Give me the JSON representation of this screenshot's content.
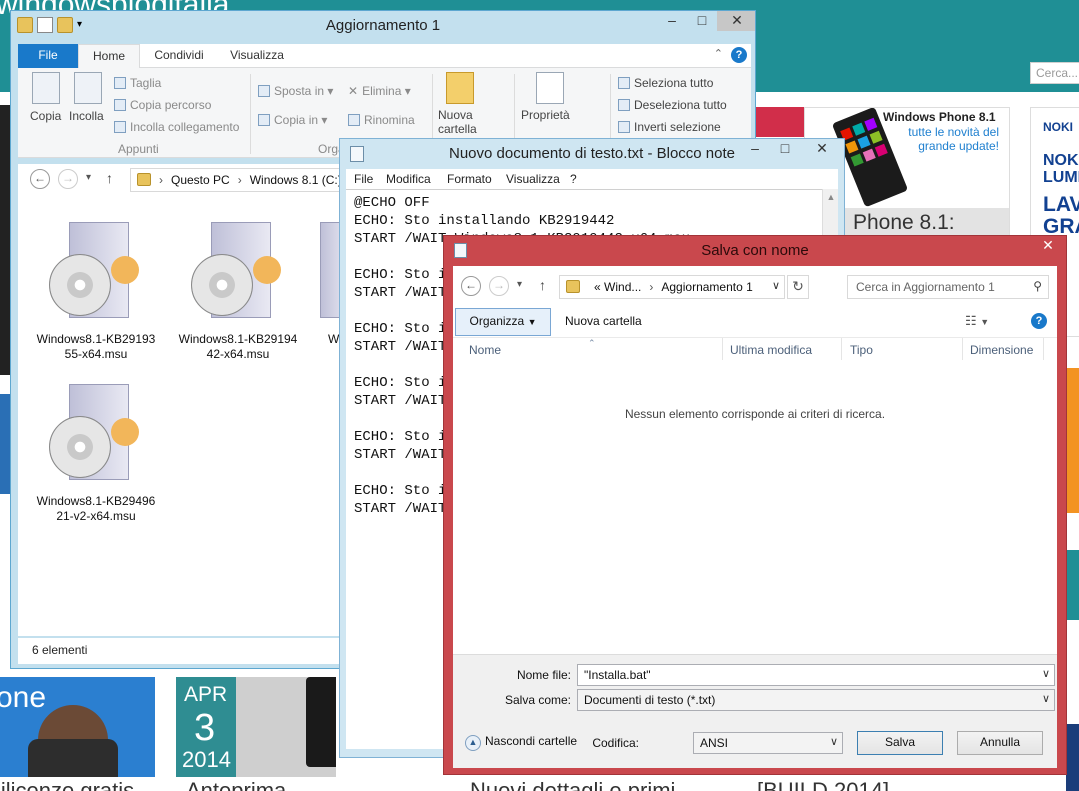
{
  "background": {
    "logo": "windowsblogitalia",
    "search_placeholder": "Cerca...",
    "ad_wp_title": "Windows Phone 8.1",
    "ad_wp_subtitle": "tutte le novità del grande update!",
    "ad_wp_bottom": "Phone 8.1:",
    "ad_nokia_1": "NOKI",
    "ad_nokia_2": "NOK LUMI",
    "ad_nokia_3": "LAV GRA",
    "news1_text": "one",
    "news2_month": "APR",
    "news2_day": "3",
    "news2_year": "2014",
    "bottom_titles": [
      "lilicenze gratis",
      "Anteprima",
      "Nuovi dettagli e primi",
      "[BUILD 2014]"
    ]
  },
  "explorer": {
    "title": "Aggiornamento 1",
    "tabs": [
      "File",
      "Home",
      "Condividi",
      "Visualizza"
    ],
    "ribbon": {
      "copy": "Copia",
      "paste": "Incolla",
      "cut": "Taglia",
      "copy_path": "Copia percorso",
      "paste_link": "Incolla collegamento",
      "group_clipboard": "Appunti",
      "move_to": "Sposta in",
      "copy_to": "Copia in",
      "delete": "Elimina",
      "rename": "Rinomina",
      "group_organize": "Organi",
      "new_folder": "Nuova cartella",
      "properties": "Proprietà",
      "select_all": "Seleziona tutto",
      "deselect_all": "Deseleziona tutto",
      "invert_selection": "Inverti selezione"
    },
    "address": [
      "Questo PC",
      "Windows 8.1 (C:)"
    ],
    "files": [
      {
        "name": "Windows8.1-KB2919355-x64.msu"
      },
      {
        "name": "Windows8.1-KB2919442-x64.msu"
      },
      {
        "name": "Wi"
      },
      {
        "name": "Windows8.1-KB2949621-v2-x64.msu"
      }
    ],
    "status": "6 elementi"
  },
  "notepad": {
    "title": "Nuovo documento di testo.txt - Blocco note",
    "menu": [
      "File",
      "Modifica",
      "Formato",
      "Visualizza",
      "?"
    ],
    "content": "@ECHO OFF\nECHO: Sto installando KB2919442\nSTART /WAIT Windows8.1-KB2919442-x64.msu\n\nECHO: Sto i\nSTART /WAIT\n\nECHO: Sto i\nSTART /WAIT\n\nECHO: Sto i\nSTART /WAIT\n\nECHO: Sto i\nSTART /WAIT\n\nECHO: Sto i\nSTART /WAIT"
  },
  "saveas": {
    "title": "Salva con nome",
    "address": [
      "Wind...",
      "Aggiornamento 1"
    ],
    "address_prefix": "«",
    "search_placeholder": "Cerca in Aggiornamento 1",
    "organize": "Organizza",
    "new_folder": "Nuova cartella",
    "columns": [
      "Nome",
      "Ultima modifica",
      "Tipo",
      "Dimensione"
    ],
    "empty_message": "Nessun elemento corrisponde ai criteri di ricerca.",
    "filename_label": "Nome file:",
    "filename_value": "\"Installa.bat\"",
    "savetype_label": "Salva come:",
    "savetype_value": "Documenti di testo (*.txt)",
    "hide_folders": "Nascondi cartelle",
    "encoding_label": "Codifica:",
    "encoding_value": "ANSI",
    "save": "Salva",
    "cancel": "Annulla"
  }
}
